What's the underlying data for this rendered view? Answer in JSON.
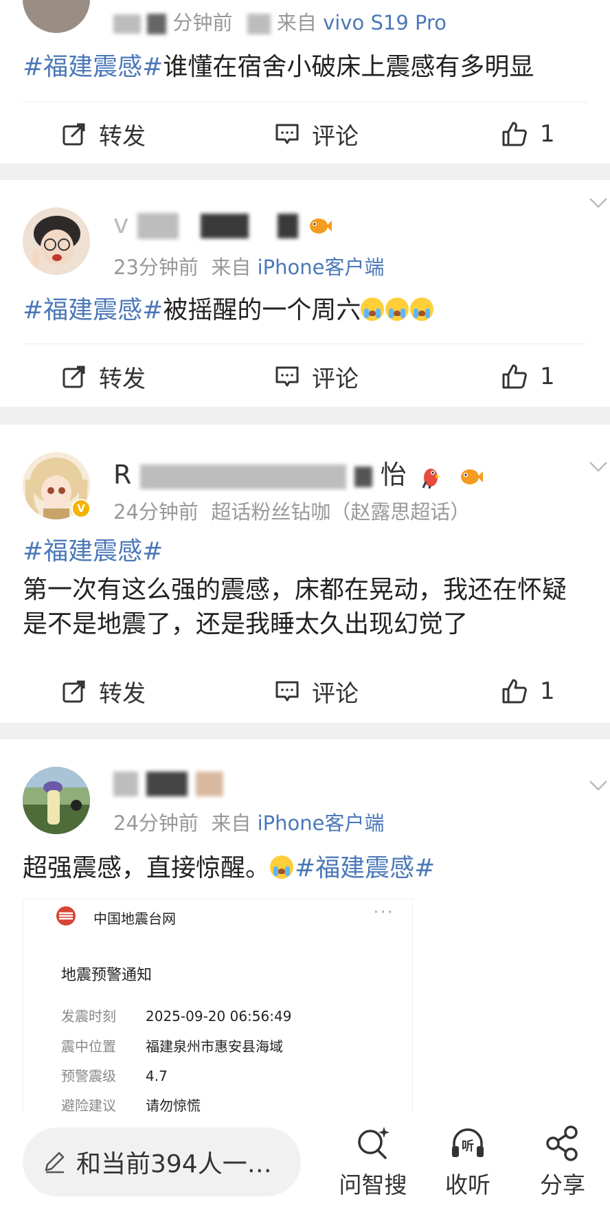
{
  "posts": [
    {
      "meta_time": "分钟前",
      "meta_from": "来自",
      "meta_source": "vivo S19 Pro",
      "tag": "#福建震感#",
      "text": "谁懂在宿舍小破床上震感有多明显",
      "repost_label": "转发",
      "comment_label": "评论",
      "like_count": "1"
    },
    {
      "user_initial": "v",
      "meta_time": "23分钟前",
      "meta_from": "来自",
      "meta_source": "iPhone客户端",
      "tag": "#福建震感#",
      "text": "被摇醒的一个周六",
      "repost_label": "转发",
      "comment_label": "评论",
      "like_count": "1"
    },
    {
      "user_name_start": "R",
      "user_name_end": "怡",
      "meta_time": "24分钟前",
      "meta_source_muted": "超话粉丝钻咖（赵露思超话）",
      "tag": "#福建震感#",
      "text_line1": "第一次有这么强的震感，床都在晃动，我还在怀疑",
      "text_line2": "是不是地震了，还是我睡太久出现幻觉了",
      "repost_label": "转发",
      "comment_label": "评论",
      "like_count": "1"
    },
    {
      "meta_time": "24分钟前",
      "meta_from": "来自",
      "meta_source": "iPhone客户端",
      "text": "超强震感，直接惊醒。",
      "tag": "#福建震感#"
    }
  ],
  "quake_notice": {
    "source": "中国地震台网",
    "more": "···",
    "title": "地震预警通知",
    "rows": [
      {
        "k": "发震时刻",
        "v": "2025-09-20 06:56:49"
      },
      {
        "k": "震中位置",
        "v": "福建泉州市惠安县海域"
      },
      {
        "k": "预警震级",
        "v": "4.7"
      },
      {
        "k": "避险建议",
        "v": "请勿惊慌"
      }
    ]
  },
  "bottom_bar": {
    "input_text": "和当前394人一…",
    "nav": [
      {
        "label": "问智搜",
        "icon": "smart-search-icon"
      },
      {
        "label": "收听",
        "icon": "listen-icon"
      },
      {
        "label": "分享",
        "icon": "share-icon"
      }
    ]
  },
  "colors": {
    "topic_blue": "#4b78b8",
    "text": "#222222",
    "meta": "#999999",
    "background": "#f0f0f0"
  }
}
